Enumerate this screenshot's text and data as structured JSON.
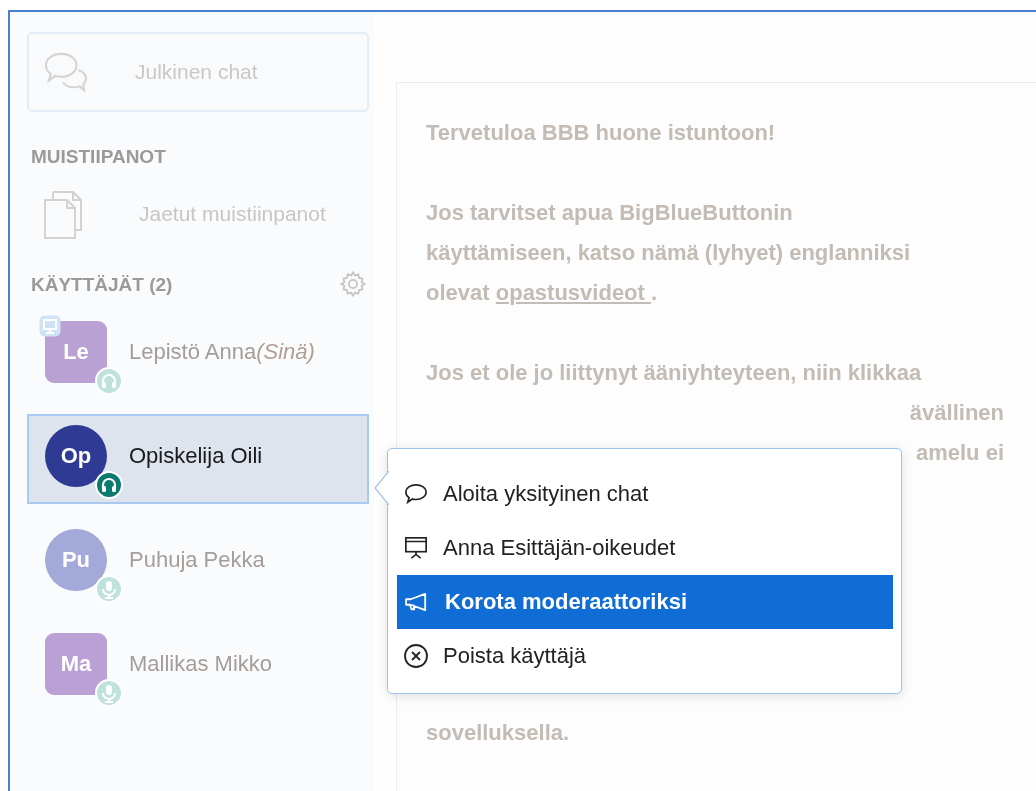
{
  "sidebar": {
    "public_chat": {
      "label": "Julkinen chat"
    },
    "notes": {
      "heading": "MUISTIIPANOT",
      "item": "Jaetut muistiinpanot"
    },
    "users": {
      "heading": "KÄYTTÄJÄT (2)",
      "items": [
        {
          "initials": "Le",
          "name": "Lepistö Anna",
          "you_label": "(Sinä)",
          "moderator": true,
          "presenter": true,
          "listen_only": true,
          "color": "#b9a2d3",
          "selected": false
        },
        {
          "initials": "Op",
          "name": "Opiskelija Oili",
          "moderator": false,
          "presenter": false,
          "listen_only": true,
          "color": "#2e3a94",
          "selected": true
        },
        {
          "initials": "Pu",
          "name": "Puhuja Pekka",
          "moderator": false,
          "presenter": false,
          "listen_only": false,
          "color": "#a3a9d9",
          "selected": false
        },
        {
          "initials": "Ma",
          "name": "Mallikas Mikko",
          "moderator": true,
          "presenter": false,
          "listen_only": false,
          "color": "#bba0d6",
          "selected": false
        }
      ]
    }
  },
  "welcome": {
    "paragraphs": [
      {
        "lines": [
          {
            "text": "Tervetuloa **BBB huone** istuntoon!"
          }
        ]
      },
      {
        "lines": [
          {
            "text": "Jos tarvitset apua BigBlueButtonin"
          },
          {
            "text": "käyttämiseen, katso nämä (lyhyet) englanniksi"
          },
          {
            "text": "olevat",
            "link": "opastusvideot ",
            "after": "."
          }
        ]
      },
      {
        "lines": [
          {
            "text": "Jos et ole jo liittynyt ääniyhteyteen, niin klikkaa"
          }
        ],
        "partly_covered_lines": [
          "ävällinen",
          "amelu ei"
        ]
      },
      {
        "lines": [
          {
            "text": "sovelluksella."
          }
        ]
      }
    ]
  },
  "context_menu": {
    "items": [
      {
        "kind": "chat",
        "label": "Aloita yksityinen chat",
        "selected": false
      },
      {
        "kind": "presenter",
        "label": "Anna Esittäjän-oikeudet",
        "selected": false
      },
      {
        "kind": "promote",
        "label": "Korota moderaattoriksi",
        "selected": true
      },
      {
        "kind": "remove",
        "label": "Poista käyttäjä",
        "selected": false
      }
    ]
  }
}
